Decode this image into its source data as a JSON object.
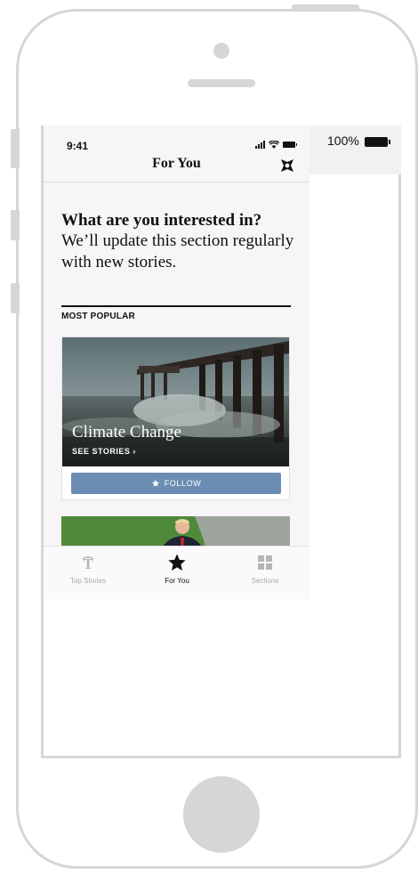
{
  "os": {
    "battery_percent": "100%"
  },
  "status_bar": {
    "time": "9:41"
  },
  "nav": {
    "title": "For You"
  },
  "intro": {
    "title": "What are you interested in?",
    "subtitle": "We’ll update this section regularly with new stories."
  },
  "section": {
    "label": "MOST POPULAR"
  },
  "cards": [
    {
      "title": "Climate Change",
      "link": "SEE STORIES ›",
      "follow_label": "FOLLOW"
    }
  ],
  "tabs": [
    {
      "label": "Top Stories",
      "icon": "nyt-logo-icon",
      "active": false
    },
    {
      "label": "For You",
      "icon": "star-icon",
      "active": true
    },
    {
      "label": "Sections",
      "icon": "grid-icon",
      "active": false
    }
  ],
  "colors": {
    "follow_button": "#6b8db3",
    "app_background": "#f8f5f8",
    "frame": "#d6d6d6"
  }
}
